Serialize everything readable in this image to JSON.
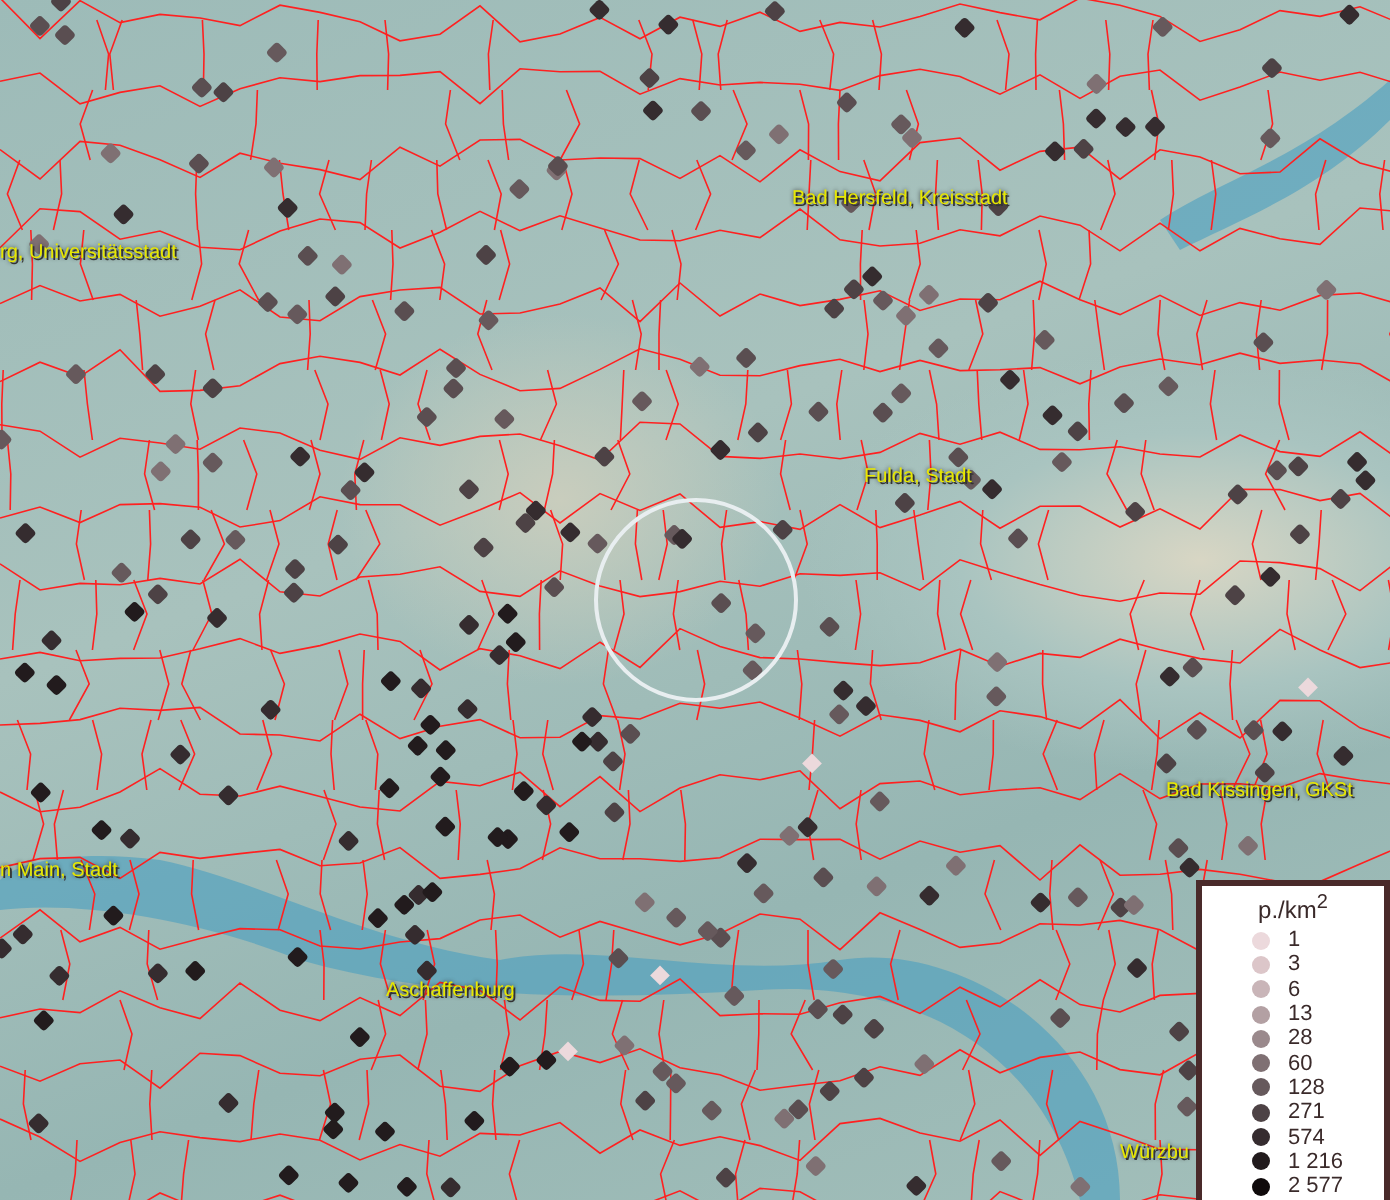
{
  "map": {
    "labels": [
      {
        "text": "rg, Universitätsstadt"
      },
      {
        "text": "Bad Hersfeld, Kreisstadt"
      },
      {
        "text": "Fulda, Stadt"
      },
      {
        "text": "Bad Kissingen, GKSt"
      },
      {
        "text": "n Main, Stadt"
      },
      {
        "text": "Aschaffenburg"
      },
      {
        "text": "Würzbu"
      }
    ]
  },
  "legend": {
    "title": "p./km$^{2}$",
    "items": [
      {
        "label": "1",
        "color": "#ecd9dc"
      },
      {
        "label": "3",
        "color": "#dcc6c9"
      },
      {
        "label": "6",
        "color": "#c9b5b8"
      },
      {
        "label": "13",
        "color": "#b3a0a3"
      },
      {
        "label": "28",
        "color": "#9a898c"
      },
      {
        "label": "60",
        "color": "#7f7073"
      },
      {
        "label": "128",
        "color": "#66595c"
      },
      {
        "label": "271",
        "color": "#4d4245"
      },
      {
        "label": "574",
        "color": "#352c2f"
      },
      {
        "label": "1 216",
        "color": "#221b1d"
      },
      {
        "label": "2 577",
        "color": "#0f0a0b"
      }
    ]
  }
}
